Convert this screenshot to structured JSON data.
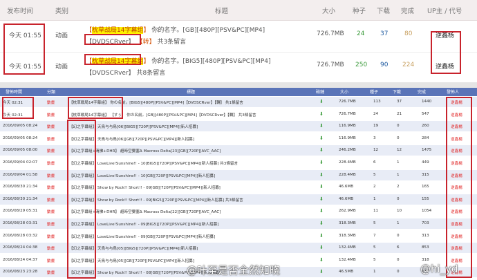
{
  "top": {
    "headers": {
      "time": "发布时间",
      "cat": "类别",
      "title": "标题",
      "size": "大小",
      "seed": "种子",
      "dl": "下载",
      "done": "完成",
      "uploader": "UP主 / 代号"
    },
    "rows": [
      {
        "time": "今天 01:55",
        "cat": "动画",
        "group": "枕草战局14字幕组",
        "title_rest": " 你的名字。[GB][480P][PSV&PC][MP4]",
        "line2_tag": "【DVDSCRver】",
        "line2_link": "【转】",
        "line2_rest": " 共3条留言",
        "size": "726.7MB",
        "seed": "24",
        "dl": "37",
        "done": "80",
        "uploader": "逆鑫杨"
      },
      {
        "time": "今天 01:55",
        "cat": "动画",
        "group": "枕草战局14字幕组",
        "title_rest": " 你的名字。[BIG5][480P][PSV&PC][MP4]",
        "line2_tag": "【DVDSCRver】",
        "line2_link": "",
        "line2_rest": " 共8条留言",
        "size": "726.7MB",
        "seed": "250",
        "dl": "90",
        "done": "224",
        "uploader": "逆鑫杨"
      }
    ]
  },
  "bottom": {
    "headers": {
      "time": "發佈時間",
      "cat": "分類",
      "title": "標題",
      "dl": "磁鏈",
      "size": "大小",
      "seed": "種子",
      "down": "下載",
      "done": "完成",
      "uploader": "發佈人"
    },
    "rows": [
      {
        "time": "今天 02:31",
        "cat": "動畫",
        "title": "【枕草戦局14字幕組】 你の名前。[BIG5][480P][PSV&PC][MP4]【DVDSCRver】【轉】 共1條留言",
        "size": "726.7MB",
        "seed": "113",
        "down": "37",
        "done": "1440",
        "up": "逆鑫楊"
      },
      {
        "time": "今天 02:31",
        "cat": "動畫",
        "title": "【枕草戦局14字幕組】 【すぅ】 你の名前。[GB][480P][PSV&PC][MP4]【DVDSCRver】【轉】 共3條留言",
        "size": "726.7MB",
        "seed": "24",
        "down": "21",
        "done": "547",
        "up": "逆鑫楊"
      },
      {
        "time": "2016/09/05 08:24",
        "cat": "動畫",
        "title": "【幻之字幕組】 天鳥与与鳥[06][BIG5][720P][PSV&PC][MP4][新人招募]",
        "size": "116.9MB",
        "seed": "19",
        "down": "0",
        "done": "260",
        "up": "逆鑫楊"
      },
      {
        "time": "2016/09/05 08:24",
        "cat": "動畫",
        "title": "【幻之字幕組】 天鳥与与鳥[06][GB][720P][PSV&PC][MP4][新人招募]",
        "size": "116.9MB",
        "seed": "3",
        "down": "0",
        "done": "284",
        "up": "逆鑫楊"
      },
      {
        "time": "2016/09/05 08:00",
        "cat": "動畫",
        "title": "【幻之字幕組+清拂+DHR】 超時空要塞Δ Macross Delta[23][GB][720P][AVC_AAC]",
        "size": "246.2MB",
        "seed": "12",
        "down": "12",
        "done": "1475",
        "up": "逆鑫楊"
      },
      {
        "time": "2016/09/04 02:07",
        "cat": "動畫",
        "title": "【幻之字幕組】 LoveLive!Sunshine!! - 10[BIG5][720P][PSV&PC][MP4][新人招募] 共3條留言",
        "size": "228.4MB",
        "seed": "6",
        "down": "1",
        "done": "449",
        "up": "逆鑫楊"
      },
      {
        "time": "2016/09/04 01:58",
        "cat": "動畫",
        "title": "【幻之字幕組】 LoveLive!Sunshine!! - 10[GB][720P][PSV&PC][MP4][新人招募]",
        "size": "228.4MB",
        "seed": "5",
        "down": "1",
        "done": "315",
        "up": "逆鑫楊"
      },
      {
        "time": "2016/08/30 21:34",
        "cat": "動畫",
        "title": "【幻之字幕組】 Show by Rock!! Short!! - 09[GB][720P][PSV&PC][MP4][新人招募]",
        "size": "46.6MB",
        "seed": "2",
        "down": "2",
        "done": "165",
        "up": "逆鑫楊"
      },
      {
        "time": "2016/08/30 21:34",
        "cat": "動畫",
        "title": "【幻之字幕組】 Show by Rock!! Short!! - 09[BIG5][720P][PSV&PC][MP4][新人招募] 共3條留言",
        "size": "46.6MB",
        "seed": "1",
        "down": "0",
        "done": "155",
        "up": "逆鑫楊"
      },
      {
        "time": "2016/08/29 05:31",
        "cat": "動畫",
        "title": "【幻之字幕組+清拂+DHR】 超時空要塞Δ Macross Delta[22][GB][720P][AVC_AAC]",
        "size": "262.9MB",
        "seed": "11",
        "down": "10",
        "done": "1054",
        "up": "逆鑫楊"
      },
      {
        "time": "2016/08/28 03:31",
        "cat": "動畫",
        "title": "【幻之字幕組】 LoveLive!Sunshine!! - 09[BIG5][720P][PSV&PC][MP4][新人招募]",
        "size": "318.3MB",
        "seed": "5",
        "down": "1",
        "done": "703",
        "up": "逆鑫楊"
      },
      {
        "time": "2016/08/28 03:32",
        "cat": "動畫",
        "title": "【幻之字幕組】 LoveLive!Sunshine!! - 09[GB][720P][PSV&PC][MP4][新人招募]",
        "size": "318.3MB",
        "seed": "7",
        "down": "0",
        "done": "313",
        "up": "逆鑫楊"
      },
      {
        "time": "2016/08/24 04:38",
        "cat": "動畫",
        "title": "【幻之字幕組】 天鳥与与鳥[05][BIG5][720P][PSV&PC][MP4][新人招募]",
        "size": "132.4MB",
        "seed": "5",
        "down": "6",
        "done": "853",
        "up": "逆鑫楊"
      },
      {
        "time": "2016/08/24 04:37",
        "cat": "動畫",
        "title": "【幻之字幕組】 天鳥与与鳥[05][GB][720P][PSV&PC][MP4][新人招募]",
        "size": "132.4MB",
        "seed": "5",
        "down": "0",
        "done": "318",
        "up": "逆鑫楊"
      },
      {
        "time": "2016/08/23 23:28",
        "cat": "動畫",
        "title": "【幻之字幕組】 Show by Rock!! Short!! - 08[GB][720P][PSV&PC][MP4][新人招募]",
        "size": "46.5MB",
        "seed": "1",
        "down": "0",
        "done": "147",
        "up": "逆鑫楊"
      }
    ]
  },
  "watermark": {
    "left": "@叶至是否全然知晓",
    "right": "@hi_yd"
  }
}
